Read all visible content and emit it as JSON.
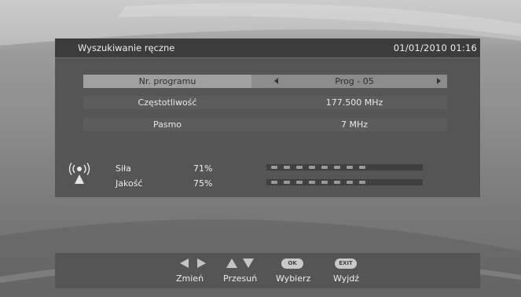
{
  "header": {
    "title": "Wyszukiwanie ręczne",
    "datetime": "01/01/2010 01:16"
  },
  "rows": {
    "program": {
      "label": "Nr. programu",
      "value": "Prog - 05"
    },
    "frequency": {
      "label": "Częstotliwość",
      "value": "177.500 MHz"
    },
    "band": {
      "label": "Pasmo",
      "value": "7 MHz"
    }
  },
  "signal": {
    "strength": {
      "label": "Siła",
      "percent_text": "71%",
      "level": 0.71
    },
    "quality": {
      "label": "Jakość",
      "percent_text": "75%",
      "level": 0.75
    }
  },
  "footer": {
    "change": "Zmień",
    "move": "Przesuń",
    "select": "Wybierz",
    "exit": "Wyjdź",
    "ok_badge": "OK",
    "exit_badge": "EXIT"
  },
  "icons": {
    "antenna": "antenna-signal-icon",
    "left_right": "left-right-arrows-icon",
    "up_down": "up-down-arrows-icon"
  },
  "colors": {
    "selected_row": "#8c8c8c",
    "panel": "#555555",
    "header": "#3c3c3c"
  }
}
